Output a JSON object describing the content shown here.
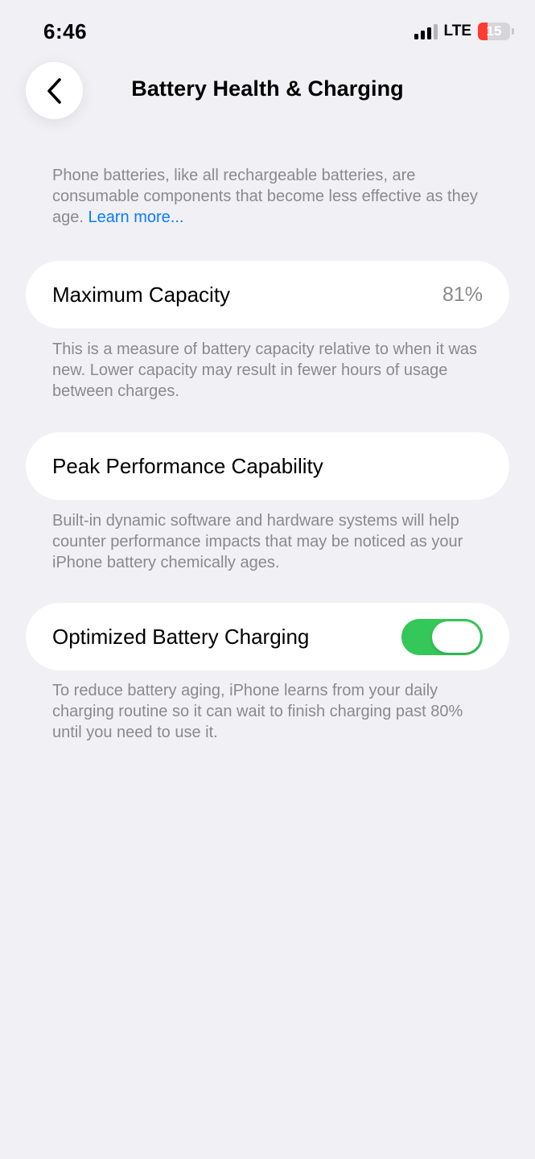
{
  "status_bar": {
    "time": "6:46",
    "network": "LTE",
    "battery_level": "15",
    "battery_fraction": 0.15,
    "signal_bars_active": 3,
    "signal_bars_total": 4
  },
  "nav": {
    "title": "Battery Health & Charging",
    "back_icon": "chevron-left-icon"
  },
  "intro": {
    "text": "Phone batteries, like all rechargeable batteries, are consumable components that become less effective as they age. ",
    "link": "Learn more..."
  },
  "max_capacity": {
    "label": "Maximum Capacity",
    "value": "81%",
    "description": "This is a measure of battery capacity relative to when it was new. Lower capacity may result in fewer hours of usage between charges."
  },
  "peak_performance": {
    "label": "Peak Performance Capability",
    "description": "Built-in dynamic software and hardware systems will help counter performance impacts that may be noticed as your iPhone battery chemically ages."
  },
  "optimized_charging": {
    "label": "Optimized Battery Charging",
    "enabled": true,
    "description": "To reduce battery aging, iPhone learns from your daily charging routine so it can wait to finish charging past 80% until you need to use it."
  },
  "colors": {
    "background": "#f0f0f5",
    "link": "#0a7aff",
    "toggle_on": "#34c759",
    "battery_low": "#ff3b30",
    "secondary_text": "#8a8a8e"
  }
}
